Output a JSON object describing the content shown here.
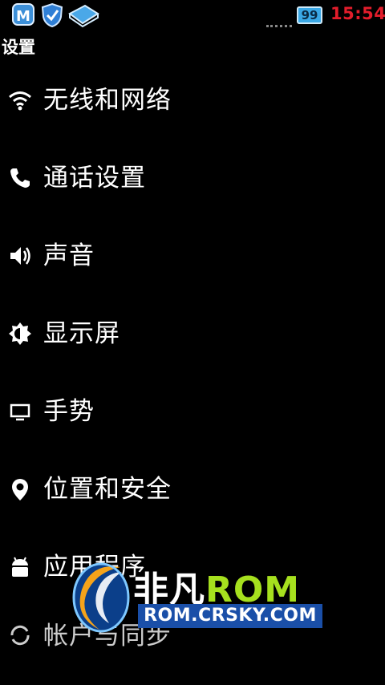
{
  "status_bar": {
    "icons": [
      "m-app-icon",
      "shield-check-icon",
      "book-icon"
    ],
    "battery_level": "99",
    "time": "15:54",
    "time_color": "#e21d2b"
  },
  "header": {
    "title": "设置"
  },
  "settings": {
    "items": [
      {
        "label": "无线和网络",
        "icon": "wifi-icon"
      },
      {
        "label": "通话设置",
        "icon": "phone-icon"
      },
      {
        "label": "声音",
        "icon": "speaker-icon"
      },
      {
        "label": "显示屏",
        "icon": "brightness-icon"
      },
      {
        "label": "手势",
        "icon": "monitor-icon"
      },
      {
        "label": "位置和安全",
        "icon": "location-pin-icon"
      },
      {
        "label": "应用程序",
        "icon": "android-icon"
      },
      {
        "label": "帐户与同步",
        "icon": "sync-icon"
      }
    ]
  },
  "watermark": {
    "brand_cn": "非凡",
    "brand_en": "ROM",
    "url": "ROM.CRSKY.COM",
    "accent": "#a6e01e"
  }
}
